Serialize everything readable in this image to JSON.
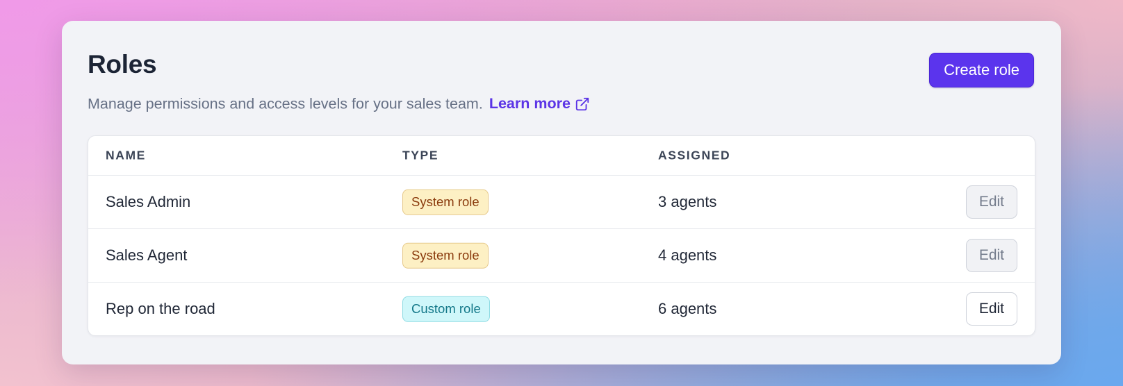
{
  "header": {
    "title": "Roles",
    "subtitle": "Manage permissions and access levels for your sales team.",
    "learn_more": "Learn more",
    "learn_more_icon": "external-link-icon",
    "create_button": "Create role"
  },
  "colors": {
    "accent": "#5b34ed",
    "system_badge_bg": "#fdf0c4",
    "system_badge_text": "#8a3a0c",
    "custom_badge_bg": "#cff7fa",
    "custom_badge_text": "#137889"
  },
  "table": {
    "columns": [
      "NAME",
      "TYPE",
      "ASSIGNED"
    ],
    "rows": [
      {
        "name": "Sales Admin",
        "type": "System role",
        "assigned": "3 agents",
        "action": "Edit",
        "action_enabled": false
      },
      {
        "name": "Sales Agent",
        "type": "System role",
        "assigned": "4 agents",
        "action": "Edit",
        "action_enabled": false
      },
      {
        "name": "Rep on the road",
        "type": "Custom role",
        "assigned": "6 agents",
        "action": "Edit",
        "action_enabled": true
      }
    ]
  }
}
